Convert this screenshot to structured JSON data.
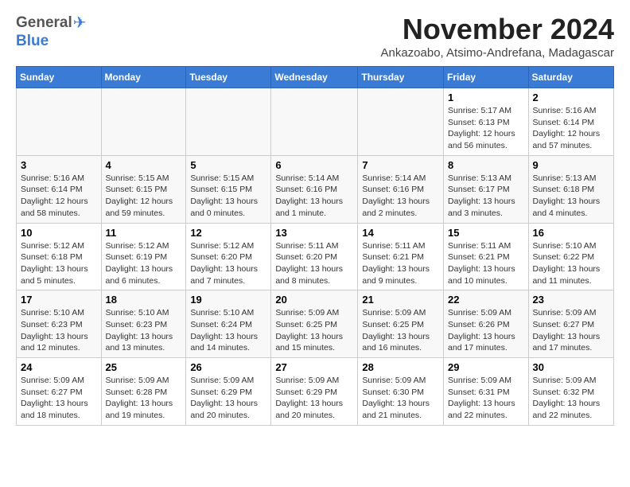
{
  "header": {
    "logo_general": "General",
    "logo_blue": "Blue",
    "title": "November 2024",
    "subtitle": "Ankazoabo, Atsimo-Andrefana, Madagascar"
  },
  "weekdays": [
    "Sunday",
    "Monday",
    "Tuesday",
    "Wednesday",
    "Thursday",
    "Friday",
    "Saturday"
  ],
  "weeks": [
    [
      {
        "day": "",
        "info": ""
      },
      {
        "day": "",
        "info": ""
      },
      {
        "day": "",
        "info": ""
      },
      {
        "day": "",
        "info": ""
      },
      {
        "day": "",
        "info": ""
      },
      {
        "day": "1",
        "info": "Sunrise: 5:17 AM\nSunset: 6:13 PM\nDaylight: 12 hours\nand 56 minutes."
      },
      {
        "day": "2",
        "info": "Sunrise: 5:16 AM\nSunset: 6:14 PM\nDaylight: 12 hours\nand 57 minutes."
      }
    ],
    [
      {
        "day": "3",
        "info": "Sunrise: 5:16 AM\nSunset: 6:14 PM\nDaylight: 12 hours\nand 58 minutes."
      },
      {
        "day": "4",
        "info": "Sunrise: 5:15 AM\nSunset: 6:15 PM\nDaylight: 12 hours\nand 59 minutes."
      },
      {
        "day": "5",
        "info": "Sunrise: 5:15 AM\nSunset: 6:15 PM\nDaylight: 13 hours\nand 0 minutes."
      },
      {
        "day": "6",
        "info": "Sunrise: 5:14 AM\nSunset: 6:16 PM\nDaylight: 13 hours\nand 1 minute."
      },
      {
        "day": "7",
        "info": "Sunrise: 5:14 AM\nSunset: 6:16 PM\nDaylight: 13 hours\nand 2 minutes."
      },
      {
        "day": "8",
        "info": "Sunrise: 5:13 AM\nSunset: 6:17 PM\nDaylight: 13 hours\nand 3 minutes."
      },
      {
        "day": "9",
        "info": "Sunrise: 5:13 AM\nSunset: 6:18 PM\nDaylight: 13 hours\nand 4 minutes."
      }
    ],
    [
      {
        "day": "10",
        "info": "Sunrise: 5:12 AM\nSunset: 6:18 PM\nDaylight: 13 hours\nand 5 minutes."
      },
      {
        "day": "11",
        "info": "Sunrise: 5:12 AM\nSunset: 6:19 PM\nDaylight: 13 hours\nand 6 minutes."
      },
      {
        "day": "12",
        "info": "Sunrise: 5:12 AM\nSunset: 6:20 PM\nDaylight: 13 hours\nand 7 minutes."
      },
      {
        "day": "13",
        "info": "Sunrise: 5:11 AM\nSunset: 6:20 PM\nDaylight: 13 hours\nand 8 minutes."
      },
      {
        "day": "14",
        "info": "Sunrise: 5:11 AM\nSunset: 6:21 PM\nDaylight: 13 hours\nand 9 minutes."
      },
      {
        "day": "15",
        "info": "Sunrise: 5:11 AM\nSunset: 6:21 PM\nDaylight: 13 hours\nand 10 minutes."
      },
      {
        "day": "16",
        "info": "Sunrise: 5:10 AM\nSunset: 6:22 PM\nDaylight: 13 hours\nand 11 minutes."
      }
    ],
    [
      {
        "day": "17",
        "info": "Sunrise: 5:10 AM\nSunset: 6:23 PM\nDaylight: 13 hours\nand 12 minutes."
      },
      {
        "day": "18",
        "info": "Sunrise: 5:10 AM\nSunset: 6:23 PM\nDaylight: 13 hours\nand 13 minutes."
      },
      {
        "day": "19",
        "info": "Sunrise: 5:10 AM\nSunset: 6:24 PM\nDaylight: 13 hours\nand 14 minutes."
      },
      {
        "day": "20",
        "info": "Sunrise: 5:09 AM\nSunset: 6:25 PM\nDaylight: 13 hours\nand 15 minutes."
      },
      {
        "day": "21",
        "info": "Sunrise: 5:09 AM\nSunset: 6:25 PM\nDaylight: 13 hours\nand 16 minutes."
      },
      {
        "day": "22",
        "info": "Sunrise: 5:09 AM\nSunset: 6:26 PM\nDaylight: 13 hours\nand 17 minutes."
      },
      {
        "day": "23",
        "info": "Sunrise: 5:09 AM\nSunset: 6:27 PM\nDaylight: 13 hours\nand 17 minutes."
      }
    ],
    [
      {
        "day": "24",
        "info": "Sunrise: 5:09 AM\nSunset: 6:27 PM\nDaylight: 13 hours\nand 18 minutes."
      },
      {
        "day": "25",
        "info": "Sunrise: 5:09 AM\nSunset: 6:28 PM\nDaylight: 13 hours\nand 19 minutes."
      },
      {
        "day": "26",
        "info": "Sunrise: 5:09 AM\nSunset: 6:29 PM\nDaylight: 13 hours\nand 20 minutes."
      },
      {
        "day": "27",
        "info": "Sunrise: 5:09 AM\nSunset: 6:29 PM\nDaylight: 13 hours\nand 20 minutes."
      },
      {
        "day": "28",
        "info": "Sunrise: 5:09 AM\nSunset: 6:30 PM\nDaylight: 13 hours\nand 21 minutes."
      },
      {
        "day": "29",
        "info": "Sunrise: 5:09 AM\nSunset: 6:31 PM\nDaylight: 13 hours\nand 22 minutes."
      },
      {
        "day": "30",
        "info": "Sunrise: 5:09 AM\nSunset: 6:32 PM\nDaylight: 13 hours\nand 22 minutes."
      }
    ]
  ]
}
